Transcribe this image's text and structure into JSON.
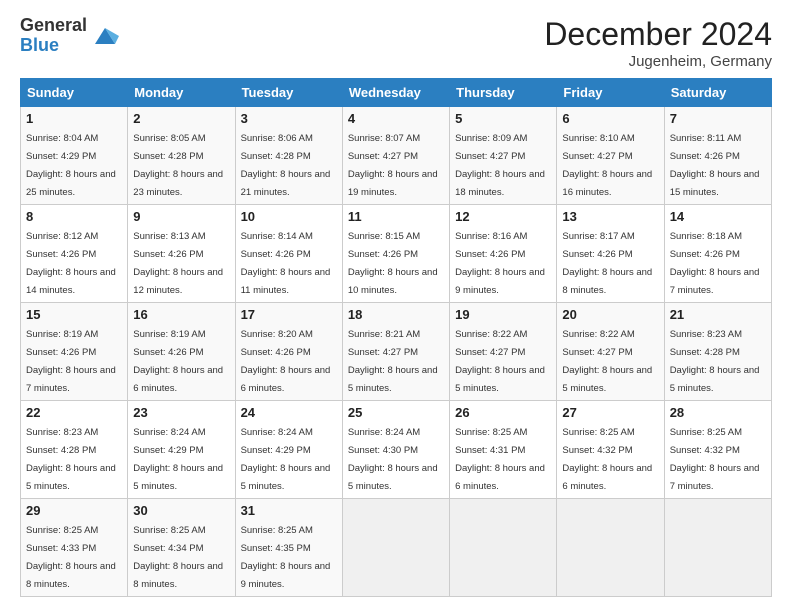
{
  "logo": {
    "general": "General",
    "blue": "Blue"
  },
  "title": "December 2024",
  "location": "Jugenheim, Germany",
  "weekdays": [
    "Sunday",
    "Monday",
    "Tuesday",
    "Wednesday",
    "Thursday",
    "Friday",
    "Saturday"
  ],
  "weeks": [
    [
      {
        "day": "1",
        "sunrise": "8:04 AM",
        "sunset": "4:29 PM",
        "daylight": "8 hours and 25 minutes."
      },
      {
        "day": "2",
        "sunrise": "8:05 AM",
        "sunset": "4:28 PM",
        "daylight": "8 hours and 23 minutes."
      },
      {
        "day": "3",
        "sunrise": "8:06 AM",
        "sunset": "4:28 PM",
        "daylight": "8 hours and 21 minutes."
      },
      {
        "day": "4",
        "sunrise": "8:07 AM",
        "sunset": "4:27 PM",
        "daylight": "8 hours and 19 minutes."
      },
      {
        "day": "5",
        "sunrise": "8:09 AM",
        "sunset": "4:27 PM",
        "daylight": "8 hours and 18 minutes."
      },
      {
        "day": "6",
        "sunrise": "8:10 AM",
        "sunset": "4:27 PM",
        "daylight": "8 hours and 16 minutes."
      },
      {
        "day": "7",
        "sunrise": "8:11 AM",
        "sunset": "4:26 PM",
        "daylight": "8 hours and 15 minutes."
      }
    ],
    [
      {
        "day": "8",
        "sunrise": "8:12 AM",
        "sunset": "4:26 PM",
        "daylight": "8 hours and 14 minutes."
      },
      {
        "day": "9",
        "sunrise": "8:13 AM",
        "sunset": "4:26 PM",
        "daylight": "8 hours and 12 minutes."
      },
      {
        "day": "10",
        "sunrise": "8:14 AM",
        "sunset": "4:26 PM",
        "daylight": "8 hours and 11 minutes."
      },
      {
        "day": "11",
        "sunrise": "8:15 AM",
        "sunset": "4:26 PM",
        "daylight": "8 hours and 10 minutes."
      },
      {
        "day": "12",
        "sunrise": "8:16 AM",
        "sunset": "4:26 PM",
        "daylight": "8 hours and 9 minutes."
      },
      {
        "day": "13",
        "sunrise": "8:17 AM",
        "sunset": "4:26 PM",
        "daylight": "8 hours and 8 minutes."
      },
      {
        "day": "14",
        "sunrise": "8:18 AM",
        "sunset": "4:26 PM",
        "daylight": "8 hours and 7 minutes."
      }
    ],
    [
      {
        "day": "15",
        "sunrise": "8:19 AM",
        "sunset": "4:26 PM",
        "daylight": "8 hours and 7 minutes."
      },
      {
        "day": "16",
        "sunrise": "8:19 AM",
        "sunset": "4:26 PM",
        "daylight": "8 hours and 6 minutes."
      },
      {
        "day": "17",
        "sunrise": "8:20 AM",
        "sunset": "4:26 PM",
        "daylight": "8 hours and 6 minutes."
      },
      {
        "day": "18",
        "sunrise": "8:21 AM",
        "sunset": "4:27 PM",
        "daylight": "8 hours and 5 minutes."
      },
      {
        "day": "19",
        "sunrise": "8:22 AM",
        "sunset": "4:27 PM",
        "daylight": "8 hours and 5 minutes."
      },
      {
        "day": "20",
        "sunrise": "8:22 AM",
        "sunset": "4:27 PM",
        "daylight": "8 hours and 5 minutes."
      },
      {
        "day": "21",
        "sunrise": "8:23 AM",
        "sunset": "4:28 PM",
        "daylight": "8 hours and 5 minutes."
      }
    ],
    [
      {
        "day": "22",
        "sunrise": "8:23 AM",
        "sunset": "4:28 PM",
        "daylight": "8 hours and 5 minutes."
      },
      {
        "day": "23",
        "sunrise": "8:24 AM",
        "sunset": "4:29 PM",
        "daylight": "8 hours and 5 minutes."
      },
      {
        "day": "24",
        "sunrise": "8:24 AM",
        "sunset": "4:29 PM",
        "daylight": "8 hours and 5 minutes."
      },
      {
        "day": "25",
        "sunrise": "8:24 AM",
        "sunset": "4:30 PM",
        "daylight": "8 hours and 5 minutes."
      },
      {
        "day": "26",
        "sunrise": "8:25 AM",
        "sunset": "4:31 PM",
        "daylight": "8 hours and 6 minutes."
      },
      {
        "day": "27",
        "sunrise": "8:25 AM",
        "sunset": "4:32 PM",
        "daylight": "8 hours and 6 minutes."
      },
      {
        "day": "28",
        "sunrise": "8:25 AM",
        "sunset": "4:32 PM",
        "daylight": "8 hours and 7 minutes."
      }
    ],
    [
      {
        "day": "29",
        "sunrise": "8:25 AM",
        "sunset": "4:33 PM",
        "daylight": "8 hours and 8 minutes."
      },
      {
        "day": "30",
        "sunrise": "8:25 AM",
        "sunset": "4:34 PM",
        "daylight": "8 hours and 8 minutes."
      },
      {
        "day": "31",
        "sunrise": "8:25 AM",
        "sunset": "4:35 PM",
        "daylight": "8 hours and 9 minutes."
      },
      null,
      null,
      null,
      null
    ]
  ]
}
